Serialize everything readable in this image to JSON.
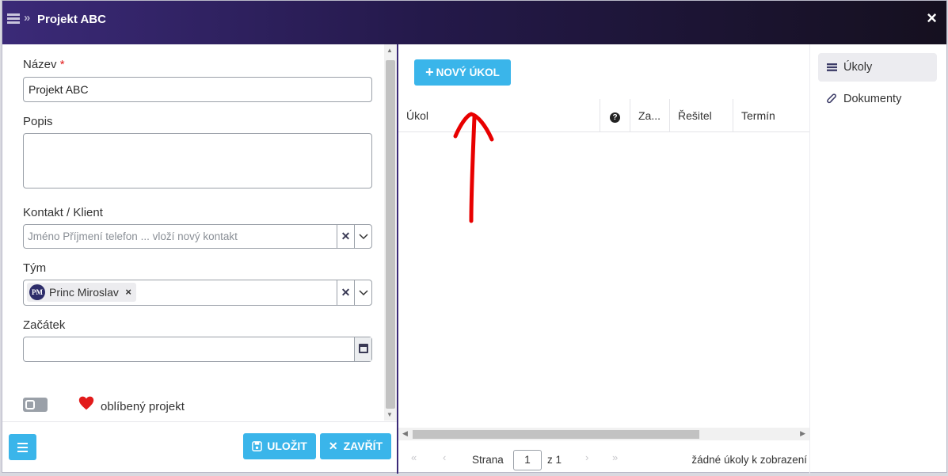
{
  "header": {
    "title": "Projekt ABC",
    "close_label": "×"
  },
  "form": {
    "name_label": "Název",
    "required_mark": "*",
    "name_value": "Projekt ABC",
    "description_label": "Popis",
    "description_value": "",
    "contact_label": "Kontakt / Klient",
    "contact_placeholder": "Jméno Příjmení telefon ... vloží nový kontakt",
    "team_label": "Tým",
    "team_members": [
      {
        "initials": "PM",
        "name": "Princ Miroslav"
      }
    ],
    "start_label": "Začátek",
    "start_value": "",
    "favorite_label": "oblíbený projekt",
    "favorite_on": false
  },
  "footer": {
    "save_label": "ULOŽIT",
    "close_label": "ZAVŘÍT"
  },
  "tasks": {
    "new_task_label": "NOVÝ ÚKOL",
    "columns": [
      "Úkol",
      "?",
      "Za...",
      "Řešitel",
      "Termín"
    ],
    "rows": [],
    "pager": {
      "page_label": "Strana",
      "page_value": "1",
      "of_label": "z 1",
      "empty_text": "žádné úkoly k zobrazení"
    }
  },
  "side_tabs": [
    {
      "label": "Úkoly",
      "icon": "list-icon",
      "active": true
    },
    {
      "label": "Dokumenty",
      "icon": "paperclip-icon",
      "active": false
    }
  ],
  "colors": {
    "accent": "#3ab5ea",
    "header_dark": "#15101f",
    "header_purple": "#3b2a78",
    "arrow": "#e80000"
  }
}
